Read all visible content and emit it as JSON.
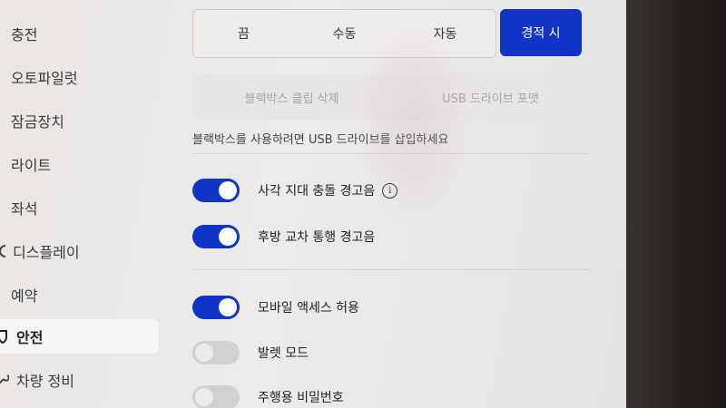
{
  "sidebar": {
    "items": [
      {
        "label": "충전",
        "icon": ""
      },
      {
        "label": "오토파일럿",
        "icon": ""
      },
      {
        "label": "잠금장치",
        "icon": ""
      },
      {
        "label": "라이트",
        "icon": ""
      },
      {
        "label": "좌석",
        "icon": ""
      },
      {
        "label": "디스플레이",
        "icon": ""
      },
      {
        "label": "예약",
        "icon": ""
      },
      {
        "label": "안전",
        "icon": "shield-icon",
        "active": true
      },
      {
        "label": "차량 정비",
        "icon": "wrench-icon"
      }
    ]
  },
  "dashcam": {
    "options": [
      "끔",
      "수동",
      "자동"
    ],
    "selected_label": "경적 시"
  },
  "actions": {
    "delete_clips": "블랙박스 클립 삭제",
    "format_usb": "USB 드라이브 포맷"
  },
  "hint": "블랙박스를 사용하려면 USB 드라이브를 삽입하세요",
  "toggles": [
    {
      "label": "사각 지대 충돌 경고음",
      "on": true,
      "info": true
    },
    {
      "label": "후방 교차 통행 경고음",
      "on": true
    },
    {
      "label": "모바일 액세스 허용",
      "on": true
    },
    {
      "label": "발렛 모드",
      "on": false
    },
    {
      "label": "주행용 비밀번호",
      "on": false
    }
  ],
  "colors": {
    "accent": "#1134c7"
  }
}
